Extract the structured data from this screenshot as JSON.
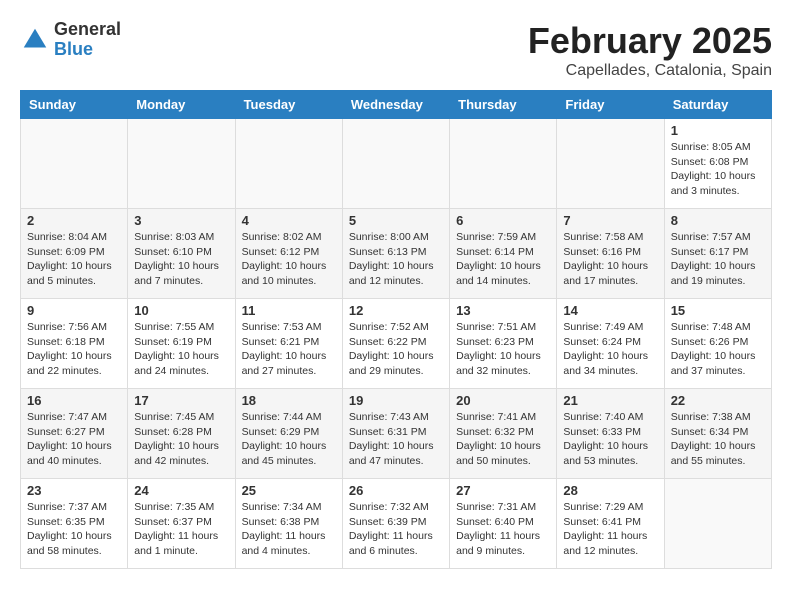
{
  "header": {
    "logo_general": "General",
    "logo_blue": "Blue",
    "month_year": "February 2025",
    "location": "Capellades, Catalonia, Spain"
  },
  "weekdays": [
    "Sunday",
    "Monday",
    "Tuesday",
    "Wednesday",
    "Thursday",
    "Friday",
    "Saturday"
  ],
  "weeks": [
    [
      {
        "day": "",
        "info": ""
      },
      {
        "day": "",
        "info": ""
      },
      {
        "day": "",
        "info": ""
      },
      {
        "day": "",
        "info": ""
      },
      {
        "day": "",
        "info": ""
      },
      {
        "day": "",
        "info": ""
      },
      {
        "day": "1",
        "info": "Sunrise: 8:05 AM\nSunset: 6:08 PM\nDaylight: 10 hours and 3 minutes."
      }
    ],
    [
      {
        "day": "2",
        "info": "Sunrise: 8:04 AM\nSunset: 6:09 PM\nDaylight: 10 hours and 5 minutes."
      },
      {
        "day": "3",
        "info": "Sunrise: 8:03 AM\nSunset: 6:10 PM\nDaylight: 10 hours and 7 minutes."
      },
      {
        "day": "4",
        "info": "Sunrise: 8:02 AM\nSunset: 6:12 PM\nDaylight: 10 hours and 10 minutes."
      },
      {
        "day": "5",
        "info": "Sunrise: 8:00 AM\nSunset: 6:13 PM\nDaylight: 10 hours and 12 minutes."
      },
      {
        "day": "6",
        "info": "Sunrise: 7:59 AM\nSunset: 6:14 PM\nDaylight: 10 hours and 14 minutes."
      },
      {
        "day": "7",
        "info": "Sunrise: 7:58 AM\nSunset: 6:16 PM\nDaylight: 10 hours and 17 minutes."
      },
      {
        "day": "8",
        "info": "Sunrise: 7:57 AM\nSunset: 6:17 PM\nDaylight: 10 hours and 19 minutes."
      }
    ],
    [
      {
        "day": "9",
        "info": "Sunrise: 7:56 AM\nSunset: 6:18 PM\nDaylight: 10 hours and 22 minutes."
      },
      {
        "day": "10",
        "info": "Sunrise: 7:55 AM\nSunset: 6:19 PM\nDaylight: 10 hours and 24 minutes."
      },
      {
        "day": "11",
        "info": "Sunrise: 7:53 AM\nSunset: 6:21 PM\nDaylight: 10 hours and 27 minutes."
      },
      {
        "day": "12",
        "info": "Sunrise: 7:52 AM\nSunset: 6:22 PM\nDaylight: 10 hours and 29 minutes."
      },
      {
        "day": "13",
        "info": "Sunrise: 7:51 AM\nSunset: 6:23 PM\nDaylight: 10 hours and 32 minutes."
      },
      {
        "day": "14",
        "info": "Sunrise: 7:49 AM\nSunset: 6:24 PM\nDaylight: 10 hours and 34 minutes."
      },
      {
        "day": "15",
        "info": "Sunrise: 7:48 AM\nSunset: 6:26 PM\nDaylight: 10 hours and 37 minutes."
      }
    ],
    [
      {
        "day": "16",
        "info": "Sunrise: 7:47 AM\nSunset: 6:27 PM\nDaylight: 10 hours and 40 minutes."
      },
      {
        "day": "17",
        "info": "Sunrise: 7:45 AM\nSunset: 6:28 PM\nDaylight: 10 hours and 42 minutes."
      },
      {
        "day": "18",
        "info": "Sunrise: 7:44 AM\nSunset: 6:29 PM\nDaylight: 10 hours and 45 minutes."
      },
      {
        "day": "19",
        "info": "Sunrise: 7:43 AM\nSunset: 6:31 PM\nDaylight: 10 hours and 47 minutes."
      },
      {
        "day": "20",
        "info": "Sunrise: 7:41 AM\nSunset: 6:32 PM\nDaylight: 10 hours and 50 minutes."
      },
      {
        "day": "21",
        "info": "Sunrise: 7:40 AM\nSunset: 6:33 PM\nDaylight: 10 hours and 53 minutes."
      },
      {
        "day": "22",
        "info": "Sunrise: 7:38 AM\nSunset: 6:34 PM\nDaylight: 10 hours and 55 minutes."
      }
    ],
    [
      {
        "day": "23",
        "info": "Sunrise: 7:37 AM\nSunset: 6:35 PM\nDaylight: 10 hours and 58 minutes."
      },
      {
        "day": "24",
        "info": "Sunrise: 7:35 AM\nSunset: 6:37 PM\nDaylight: 11 hours and 1 minute."
      },
      {
        "day": "25",
        "info": "Sunrise: 7:34 AM\nSunset: 6:38 PM\nDaylight: 11 hours and 4 minutes."
      },
      {
        "day": "26",
        "info": "Sunrise: 7:32 AM\nSunset: 6:39 PM\nDaylight: 11 hours and 6 minutes."
      },
      {
        "day": "27",
        "info": "Sunrise: 7:31 AM\nSunset: 6:40 PM\nDaylight: 11 hours and 9 minutes."
      },
      {
        "day": "28",
        "info": "Sunrise: 7:29 AM\nSunset: 6:41 PM\nDaylight: 11 hours and 12 minutes."
      },
      {
        "day": "",
        "info": ""
      }
    ]
  ]
}
